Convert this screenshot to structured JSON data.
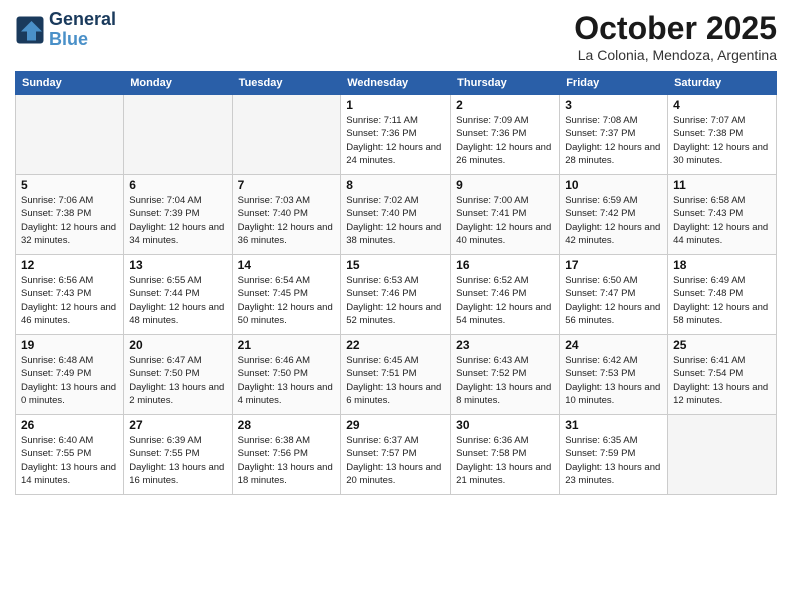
{
  "header": {
    "logo_line1": "General",
    "logo_line2": "Blue",
    "month": "October 2025",
    "location": "La Colonia, Mendoza, Argentina"
  },
  "weekdays": [
    "Sunday",
    "Monday",
    "Tuesday",
    "Wednesday",
    "Thursday",
    "Friday",
    "Saturday"
  ],
  "weeks": [
    [
      {
        "day": "",
        "empty": true
      },
      {
        "day": "",
        "empty": true
      },
      {
        "day": "",
        "empty": true
      },
      {
        "day": "1",
        "sunrise": "7:11 AM",
        "sunset": "7:36 PM",
        "daylight": "12 hours and 24 minutes."
      },
      {
        "day": "2",
        "sunrise": "7:09 AM",
        "sunset": "7:36 PM",
        "daylight": "12 hours and 26 minutes."
      },
      {
        "day": "3",
        "sunrise": "7:08 AM",
        "sunset": "7:37 PM",
        "daylight": "12 hours and 28 minutes."
      },
      {
        "day": "4",
        "sunrise": "7:07 AM",
        "sunset": "7:38 PM",
        "daylight": "12 hours and 30 minutes."
      }
    ],
    [
      {
        "day": "5",
        "sunrise": "7:06 AM",
        "sunset": "7:38 PM",
        "daylight": "12 hours and 32 minutes."
      },
      {
        "day": "6",
        "sunrise": "7:04 AM",
        "sunset": "7:39 PM",
        "daylight": "12 hours and 34 minutes."
      },
      {
        "day": "7",
        "sunrise": "7:03 AM",
        "sunset": "7:40 PM",
        "daylight": "12 hours and 36 minutes."
      },
      {
        "day": "8",
        "sunrise": "7:02 AM",
        "sunset": "7:40 PM",
        "daylight": "12 hours and 38 minutes."
      },
      {
        "day": "9",
        "sunrise": "7:00 AM",
        "sunset": "7:41 PM",
        "daylight": "12 hours and 40 minutes."
      },
      {
        "day": "10",
        "sunrise": "6:59 AM",
        "sunset": "7:42 PM",
        "daylight": "12 hours and 42 minutes."
      },
      {
        "day": "11",
        "sunrise": "6:58 AM",
        "sunset": "7:43 PM",
        "daylight": "12 hours and 44 minutes."
      }
    ],
    [
      {
        "day": "12",
        "sunrise": "6:56 AM",
        "sunset": "7:43 PM",
        "daylight": "12 hours and 46 minutes."
      },
      {
        "day": "13",
        "sunrise": "6:55 AM",
        "sunset": "7:44 PM",
        "daylight": "12 hours and 48 minutes."
      },
      {
        "day": "14",
        "sunrise": "6:54 AM",
        "sunset": "7:45 PM",
        "daylight": "12 hours and 50 minutes."
      },
      {
        "day": "15",
        "sunrise": "6:53 AM",
        "sunset": "7:46 PM",
        "daylight": "12 hours and 52 minutes."
      },
      {
        "day": "16",
        "sunrise": "6:52 AM",
        "sunset": "7:46 PM",
        "daylight": "12 hours and 54 minutes."
      },
      {
        "day": "17",
        "sunrise": "6:50 AM",
        "sunset": "7:47 PM",
        "daylight": "12 hours and 56 minutes."
      },
      {
        "day": "18",
        "sunrise": "6:49 AM",
        "sunset": "7:48 PM",
        "daylight": "12 hours and 58 minutes."
      }
    ],
    [
      {
        "day": "19",
        "sunrise": "6:48 AM",
        "sunset": "7:49 PM",
        "daylight": "13 hours and 0 minutes."
      },
      {
        "day": "20",
        "sunrise": "6:47 AM",
        "sunset": "7:50 PM",
        "daylight": "13 hours and 2 minutes."
      },
      {
        "day": "21",
        "sunrise": "6:46 AM",
        "sunset": "7:50 PM",
        "daylight": "13 hours and 4 minutes."
      },
      {
        "day": "22",
        "sunrise": "6:45 AM",
        "sunset": "7:51 PM",
        "daylight": "13 hours and 6 minutes."
      },
      {
        "day": "23",
        "sunrise": "6:43 AM",
        "sunset": "7:52 PM",
        "daylight": "13 hours and 8 minutes."
      },
      {
        "day": "24",
        "sunrise": "6:42 AM",
        "sunset": "7:53 PM",
        "daylight": "13 hours and 10 minutes."
      },
      {
        "day": "25",
        "sunrise": "6:41 AM",
        "sunset": "7:54 PM",
        "daylight": "13 hours and 12 minutes."
      }
    ],
    [
      {
        "day": "26",
        "sunrise": "6:40 AM",
        "sunset": "7:55 PM",
        "daylight": "13 hours and 14 minutes."
      },
      {
        "day": "27",
        "sunrise": "6:39 AM",
        "sunset": "7:55 PM",
        "daylight": "13 hours and 16 minutes."
      },
      {
        "day": "28",
        "sunrise": "6:38 AM",
        "sunset": "7:56 PM",
        "daylight": "13 hours and 18 minutes."
      },
      {
        "day": "29",
        "sunrise": "6:37 AM",
        "sunset": "7:57 PM",
        "daylight": "13 hours and 20 minutes."
      },
      {
        "day": "30",
        "sunrise": "6:36 AM",
        "sunset": "7:58 PM",
        "daylight": "13 hours and 21 minutes."
      },
      {
        "day": "31",
        "sunrise": "6:35 AM",
        "sunset": "7:59 PM",
        "daylight": "13 hours and 23 minutes."
      },
      {
        "day": "",
        "empty": true
      }
    ]
  ]
}
